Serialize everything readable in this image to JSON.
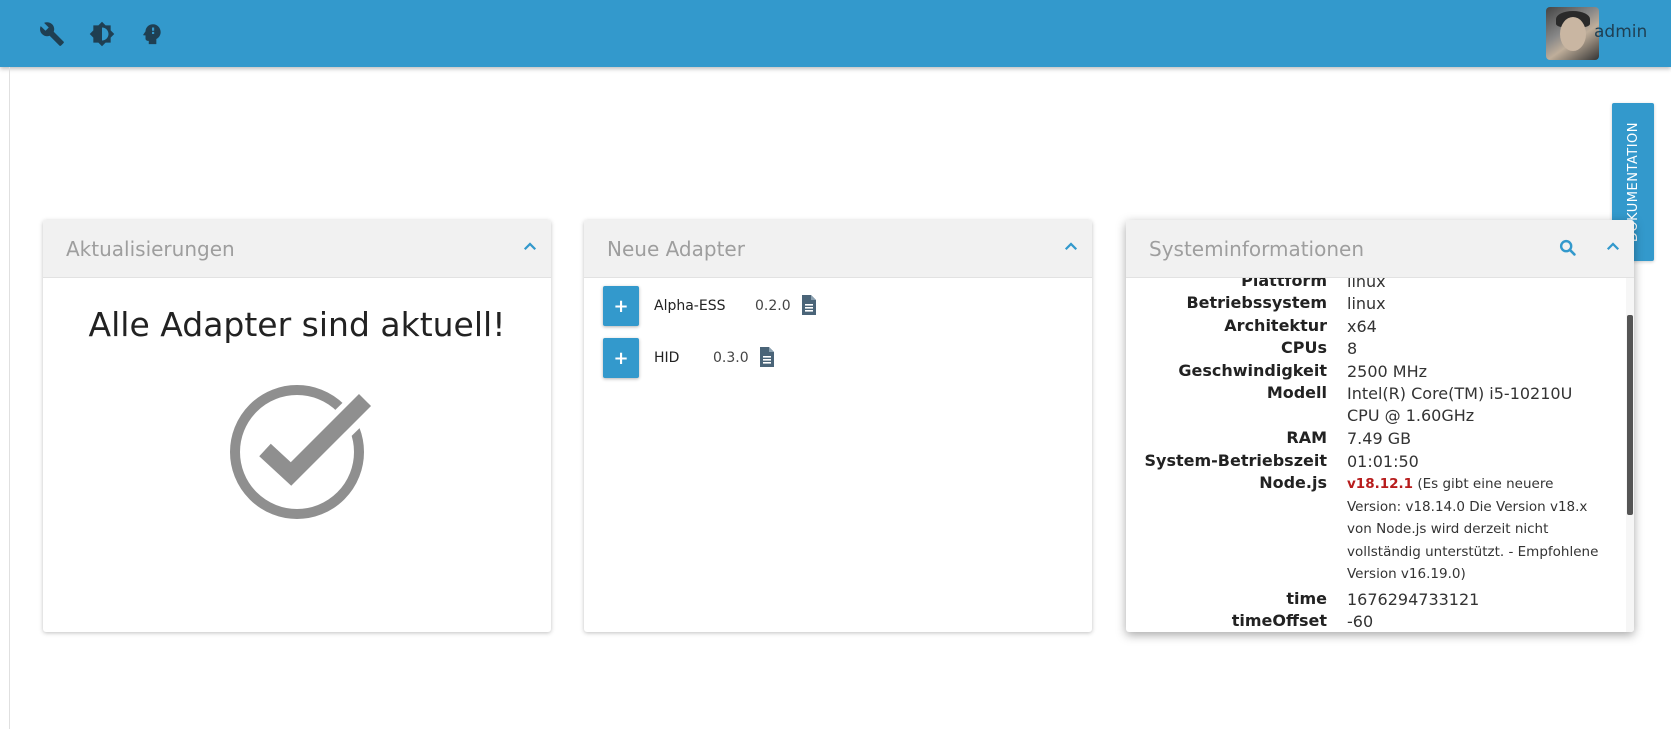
{
  "topbar": {
    "icons": [
      "wrench-icon",
      "brightness-icon",
      "expert-mode-icon"
    ],
    "user": "admin"
  },
  "doc_tab": "DOKUMENTATION",
  "updates": {
    "title": "Aktualisierungen",
    "message": "Alle Adapter sind aktuell!"
  },
  "new_adapters": {
    "title": "Neue Adapter",
    "items": [
      {
        "name": "Alpha-ESS",
        "version": "0.2.0"
      },
      {
        "name": "HID",
        "version": "0.3.0"
      }
    ]
  },
  "system_info": {
    "title": "Systeminformationen",
    "rows": [
      {
        "key": "Plattform",
        "value": "linux"
      },
      {
        "key": "Betriebssystem",
        "value": "linux"
      },
      {
        "key": "Architektur",
        "value": "x64"
      },
      {
        "key": "CPUs",
        "value": "8"
      },
      {
        "key": "Geschwindigkeit",
        "value": "2500 MHz"
      },
      {
        "key": "Modell",
        "value": "Intel(R) Core(TM) i5-10210U CPU @ 1.60GHz"
      },
      {
        "key": "RAM",
        "value": "7.49 GB"
      },
      {
        "key": "System-Betriebszeit",
        "value": "01:01:50"
      },
      {
        "key": "Node.js",
        "value": "v18.12.1",
        "note": " (Es gibt eine neuere Version: v18.14.0 Die Version v18.x von Node.js wird derzeit nicht vollständig unterstützt. - Empfohlene Version v16.19.0)"
      },
      {
        "key": "time",
        "value": "1676294733121"
      },
      {
        "key": "timeOffset",
        "value": "-60"
      }
    ]
  },
  "colors": {
    "primary": "#3399cc",
    "header_bg": "#f1f1f1",
    "warning_text": "#b71c1c"
  }
}
